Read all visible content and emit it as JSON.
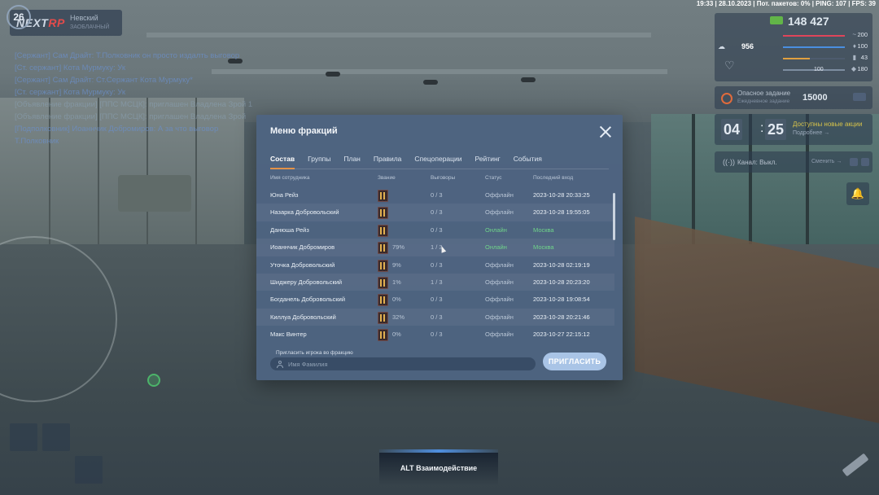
{
  "top_info": "19:33 | 28.10.2023 | Пот. пакетов: 0% | PING: 107 | FPS: 39",
  "server": {
    "logo_text": "NEXT",
    "logo_num": "RP",
    "logo_sub": "",
    "name": "Невский",
    "subname": "ЗАОБЛАЧНЫЙ"
  },
  "chat": [
    "[Сержант] Сам Драйт: Т.Полковник он просто издалть выговор",
    "[Ст. сержант] Кота Мурмуку: Ук",
    "[Сержант] Сам Драйт: Ст.Сержант Кота Мурмуку*",
    "[Ст. сержант] Кота Мурмуку: Ук",
    "[Объявление фракции] [ППС МСЦК]: приглашен Владлена Зрой 1",
    "[Объявление фракции] [ППС МСЦК]: приглашен Владлена Зрой",
    "[Подполковник] Иоаннчик Добромиров: А за что выговор",
    "Т.Полковник"
  ],
  "hud": {
    "level": "26",
    "level_sub": "",
    "money": "148 427",
    "stat_a_value": "956",
    "health_label": "",
    "bars": [
      {
        "value": "200",
        "icon": "pulse-icon",
        "color": "#e0455a",
        "fill": 1.0
      },
      {
        "value": "100",
        "icon": "mic-icon",
        "color": "#4a8fe0",
        "fill": 1.0
      },
      {
        "value": "43",
        "icon": "fuel-icon",
        "color": "#e0a040",
        "fill": 0.43
      },
      {
        "value": "180",
        "icon": "shield-icon",
        "color": "#7d8da0",
        "fill": 1.0
      }
    ],
    "armor_value": "100",
    "task": {
      "title": "Опасное задание",
      "subtitle": "Ежедневное задание",
      "reward": "15000",
      "badge": ""
    },
    "timer": {
      "min": "04",
      "sec": "25",
      "available": "Доступны новые акции",
      "more": "Подробнее →"
    },
    "radio": {
      "label": "Канал: Выкл.",
      "change": "Сменить →"
    }
  },
  "interaction": "ALT Взаимодействие",
  "modal": {
    "title": "Меню фракций",
    "tabs": [
      "Состав",
      "Группы",
      "План",
      "Правила",
      "Спецоперации",
      "Рейтинг",
      "События"
    ],
    "columns": [
      "Имя сотрудника",
      "Звание",
      "Выговоры",
      "Статус",
      "Последний вход"
    ],
    "rows": [
      {
        "name": "Юна Рейз",
        "pct": "",
        "warns": "0 / 3",
        "status": "Оффлайн",
        "last": "2023-10-28 20:33:25",
        "online": false
      },
      {
        "name": "Назарка Добровольский",
        "pct": "",
        "warns": "0 / 3",
        "status": "Оффлайн",
        "last": "2023-10-28 19:55:05",
        "online": false
      },
      {
        "name": "Данюша Рейз",
        "pct": "",
        "warns": "0 / 3",
        "status": "Онлайн",
        "last": "Москва",
        "online": true
      },
      {
        "name": "Иоаннчик Добромиров",
        "pct": "79%",
        "warns": "1 / 3",
        "status": "Онлайн",
        "last": "Москва",
        "online": true
      },
      {
        "name": "Уточка Добровольский",
        "pct": "9%",
        "warns": "0 / 3",
        "status": "Оффлайн",
        "last": "2023-10-28 02:19:19",
        "online": false
      },
      {
        "name": "Шиджеру Добровольский",
        "pct": "1%",
        "warns": "1 / 3",
        "status": "Оффлайн",
        "last": "2023-10-28 20:23:20",
        "online": false
      },
      {
        "name": "Богданель Добровольский",
        "pct": "0%",
        "warns": "0 / 3",
        "status": "Оффлайн",
        "last": "2023-10-28 19:08:54",
        "online": false
      },
      {
        "name": "Киллуа Добровольский",
        "pct": "32%",
        "warns": "0 / 3",
        "status": "Оффлайн",
        "last": "2023-10-28 20:21:46",
        "online": false
      },
      {
        "name": "Макс Винтер",
        "pct": "0%",
        "warns": "0 / 3",
        "status": "Оффлайн",
        "last": "2023-10-27 22:15:12",
        "online": false
      }
    ],
    "invite_label": "Пригласить игрока во фракцию",
    "invite_placeholder": "Имя Фамилия",
    "invite_button": "ПРИГЛАСИТЬ"
  },
  "colors": {
    "accent": "#e08a3a",
    "online": "#6fd48a",
    "modal_bg": "#4e6482",
    "button": "#a9c4e6"
  }
}
